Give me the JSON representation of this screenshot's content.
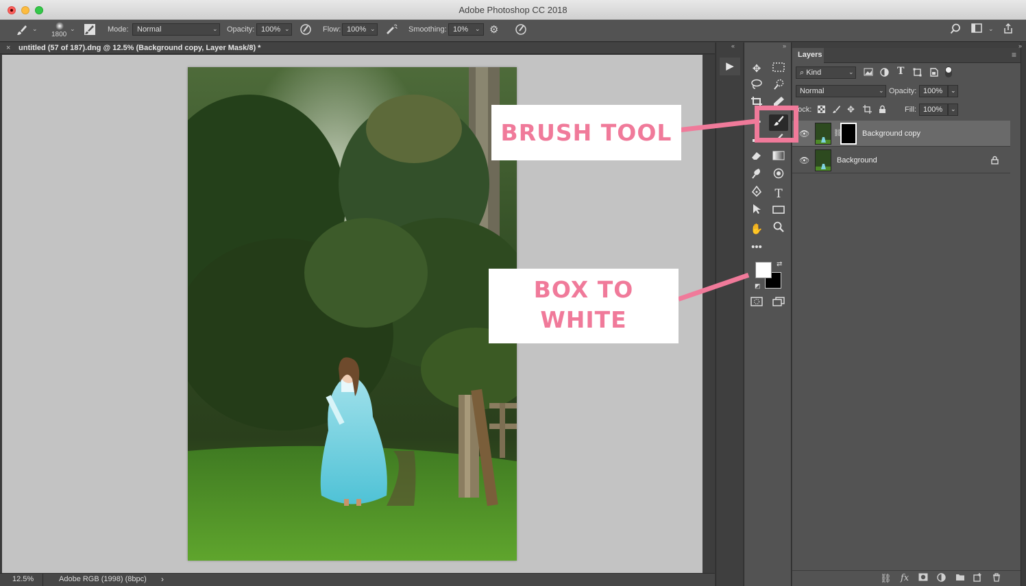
{
  "window": {
    "title": "Adobe Photoshop CC 2018"
  },
  "options_bar": {
    "brush_size": "1800",
    "mode_label": "Mode:",
    "mode_value": "Normal",
    "opacity_label": "Opacity:",
    "opacity_value": "100%",
    "flow_label": "Flow:",
    "flow_value": "100%",
    "smoothing_label": "Smoothing:",
    "smoothing_value": "10%"
  },
  "document": {
    "tab_title": "untitled (57 of 187).dng @ 12.5% (Background copy, Layer Mask/8) *",
    "close_glyph": "×"
  },
  "status_bar": {
    "zoom": "12.5%",
    "color_profile": "Adobe RGB (1998) (8bpc)",
    "arrow": "›"
  },
  "layers_panel": {
    "tab_label": "Layers",
    "filter_kind": "Kind",
    "blend_mode": "Normal",
    "opacity_label": "Opacity:",
    "opacity_value": "100%",
    "lock_label": "Lock:",
    "fill_label": "Fill:",
    "fill_value": "100%",
    "layers": [
      {
        "name": "Background copy",
        "selected": true,
        "has_mask": true
      },
      {
        "name": "Background",
        "selected": false,
        "locked": true
      }
    ]
  },
  "toolbox": {
    "active_tool": "brush-tool",
    "foreground_color": "#ffffff",
    "background_color": "#000000"
  },
  "annotations": {
    "brush_tool": "BRUSH TOOL",
    "box_to_white_line1": "BOX TO",
    "box_to_white_line2": "WHITE",
    "accent_color": "#f07a9a"
  }
}
